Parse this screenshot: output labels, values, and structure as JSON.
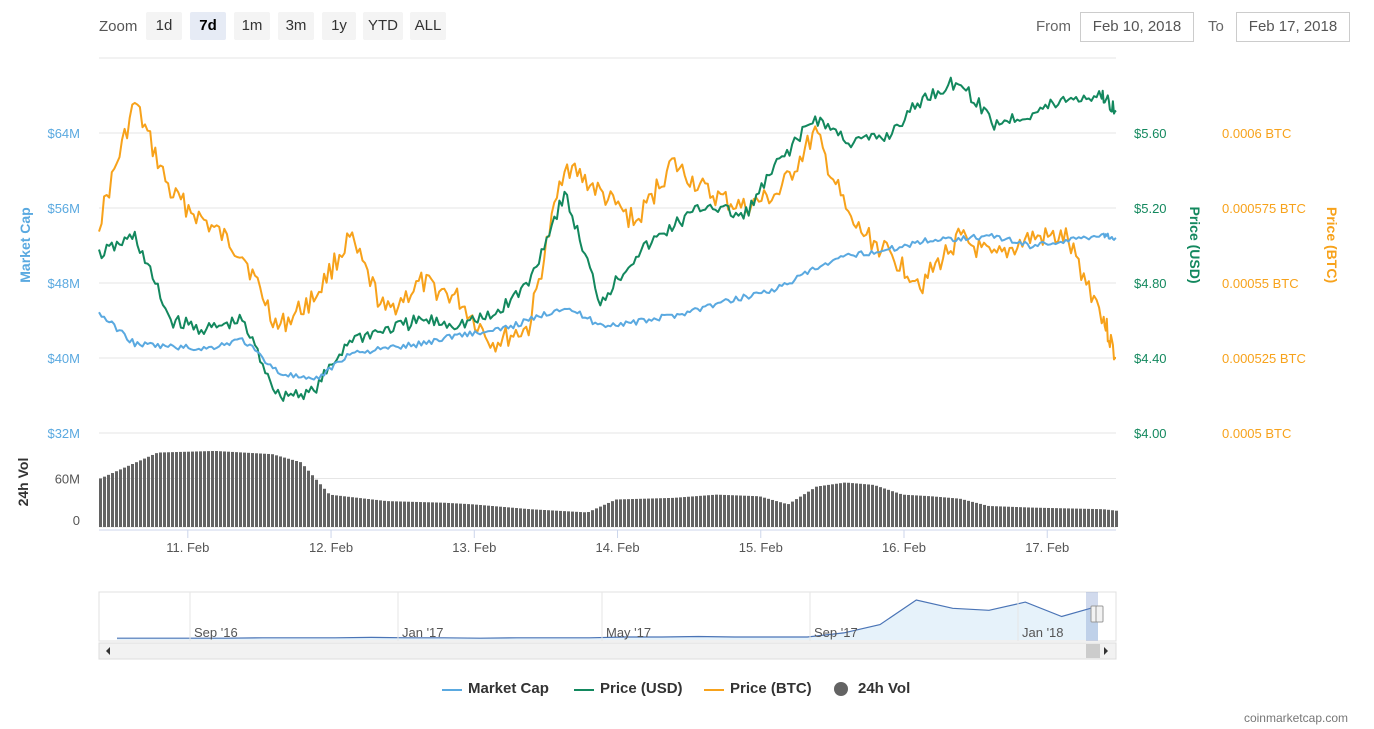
{
  "toolbar": {
    "zoom_label": "Zoom",
    "buttons": [
      "1d",
      "7d",
      "1m",
      "3m",
      "1y",
      "YTD",
      "ALL"
    ],
    "active": "7d",
    "from_label": "From",
    "from_value": "Feb 10, 2018",
    "to_label": "To",
    "to_value": "Feb 17, 2018"
  },
  "legend": {
    "market_cap": "Market Cap",
    "price_usd": "Price (USD)",
    "price_btc": "Price (BTC)",
    "vol": "24h Vol"
  },
  "credit": "coinmarketcap.com",
  "colors": {
    "market_cap": "#5aa9e0",
    "price_usd": "#13885e",
    "price_btc": "#f7a21b",
    "volume": "#636363"
  },
  "chart_data": {
    "type": "line",
    "x_ticks": [
      "11. Feb",
      "12. Feb",
      "13. Feb",
      "14. Feb",
      "15. Feb",
      "16. Feb",
      "17. Feb"
    ],
    "x_range": [
      "Feb 10, 2018 09:00",
      "Feb 17, 2018 11:00"
    ],
    "axes": {
      "market_cap": {
        "label": "Market Cap",
        "ticks": [
          "$32M",
          "$40M",
          "$48M",
          "$56M",
          "$64M"
        ],
        "range": [
          32,
          72
        ],
        "unit": "M USD"
      },
      "price_usd": {
        "label": "Price (USD)",
        "ticks": [
          "$4.00",
          "$4.40",
          "$4.80",
          "$5.20",
          "$5.60"
        ],
        "range": [
          4.0,
          6.0
        ]
      },
      "price_btc": {
        "label": "Price (BTC)",
        "ticks": [
          "0.0005 BTC",
          "0.000525 BTC",
          "0.00055 BTC",
          "0.000575 BTC",
          "0.0006 BTC"
        ],
        "range": [
          0.0005,
          0.000625
        ]
      },
      "volume": {
        "label": "24h Vol",
        "ticks": [
          "0",
          "60M"
        ],
        "range": [
          0,
          110
        ],
        "unit": "M USD"
      }
    },
    "x": [
      0,
      0.25,
      0.5,
      0.75,
      1,
      1.25,
      1.5,
      1.75,
      2,
      2.25,
      2.5,
      2.75,
      3,
      3.25,
      3.5,
      3.75,
      4,
      4.25,
      4.5,
      4.75,
      5,
      5.25,
      5.5,
      5.75,
      6,
      6.25,
      6.5,
      6.75,
      7,
      7.1
    ],
    "series": [
      {
        "name": "Market Cap",
        "axis": "market_cap",
        "values": [
          44.8,
          41.5,
          41.2,
          41.0,
          42.0,
          38.5,
          37.5,
          40.5,
          41.0,
          41.5,
          42.5,
          42.8,
          44.0,
          45.5,
          43.5,
          43.8,
          44.5,
          45.5,
          46.5,
          47.5,
          49.5,
          51.0,
          51.5,
          52.5,
          52.8,
          53.0,
          52.0,
          52.5,
          53.2,
          52.8
        ]
      },
      {
        "name": "Price (USD)",
        "axis": "price_usd",
        "values": [
          4.95,
          5.05,
          4.6,
          4.55,
          4.6,
          4.2,
          4.22,
          4.5,
          4.55,
          4.6,
          4.58,
          4.62,
          4.8,
          5.28,
          4.7,
          4.95,
          5.1,
          5.22,
          5.15,
          5.45,
          5.68,
          5.55,
          5.58,
          5.78,
          5.88,
          5.65,
          5.7,
          5.78,
          5.8,
          5.72
        ]
      },
      {
        "name": "Price (BTC)",
        "axis": "price_btc",
        "values": [
          0.00057,
          0.00061,
          0.00058,
          0.00057,
          0.00056,
          0.000535,
          0.000545,
          0.000565,
          0.00054,
          0.00055,
          0.000545,
          0.00053,
          0.000535,
          0.00059,
          0.00058,
          0.00057,
          0.00059,
          0.00058,
          0.000575,
          0.00058,
          0.0006,
          0.00057,
          0.00056,
          0.00055,
          0.000565,
          0.000558,
          0.000565,
          0.000565,
          0.00054,
          0.000525
        ]
      }
    ],
    "volume": {
      "x": [
        0,
        0.4,
        0.8,
        1.2,
        1.4,
        1.6,
        2,
        2.4,
        2.6,
        3,
        3.2,
        3.4,
        3.6,
        4,
        4.3,
        4.6,
        4.8,
        5,
        5.2,
        5.4,
        5.6,
        5.8,
        6,
        6.2,
        6.5,
        7,
        7.1
      ],
      "values": [
        60,
        92,
        94,
        90,
        80,
        40,
        32,
        30,
        28,
        22,
        20,
        18,
        34,
        36,
        40,
        38,
        28,
        50,
        55,
        52,
        40,
        38,
        35,
        26,
        24,
        22,
        20
      ]
    },
    "navigator": {
      "x_ticks": [
        "Sep '16",
        "Jan '17",
        "May '17",
        "Sep '17",
        "Jan '18"
      ],
      "shape": [
        0.02,
        0.02,
        0.02,
        0.02,
        0.03,
        0.03,
        0.03,
        0.04,
        0.03,
        0.03,
        0.02,
        0.03,
        0.03,
        0.03,
        0.05,
        0.05,
        0.06,
        0.05,
        0.05,
        0.05,
        0.15,
        0.35,
        0.95,
        0.75,
        0.7,
        0.9,
        0.55,
        0.8
      ]
    }
  }
}
